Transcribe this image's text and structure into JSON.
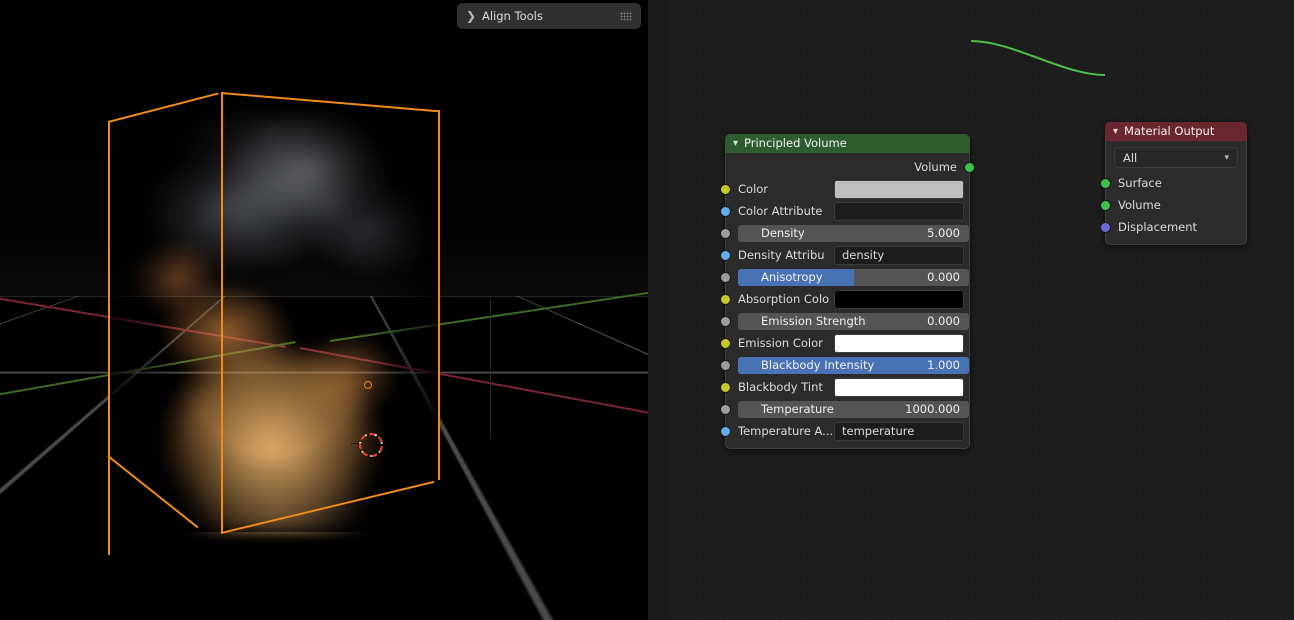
{
  "viewport": {
    "name": "3d-viewport",
    "object": "smoke-domain-volume",
    "overlay_panel": {
      "title": "Align Tools",
      "expand_icon": "chevron-right-icon",
      "grip_icon": "grip-dots-icon"
    },
    "axis_colors": {
      "x": "#7a2434",
      "y": "#3f6a22"
    },
    "selection_color": "#f08a18",
    "grid_color": "#787878"
  },
  "node_editor": {
    "name": "shader-node-editor",
    "background": "#1d1d1d",
    "link_color": "#4cbf4c",
    "nodes": [
      {
        "id": "principled-volume",
        "title": "Principled Volume",
        "header_color": "#2e5c2e",
        "collapse_icon": "chevron-down-icon",
        "outputs": [
          {
            "label": "Volume",
            "socket": "shader",
            "color": "#3fc14b"
          }
        ],
        "inputs": [
          {
            "label": "Color",
            "socket": "color",
            "widget": "swatch",
            "value": "#bfbfbf"
          },
          {
            "label": "Color Attribute",
            "socket": "string",
            "widget": "text",
            "value": ""
          },
          {
            "label": "Density",
            "socket": "float",
            "widget": "number",
            "value": "5.000",
            "fill": 0
          },
          {
            "label": "Density Attribu",
            "socket": "string",
            "widget": "text",
            "value": "density"
          },
          {
            "label": "Anisotropy",
            "socket": "float",
            "widget": "slider",
            "value": "0.000",
            "fill": 50
          },
          {
            "label": "Absorption Colo",
            "socket": "color",
            "widget": "swatch",
            "value": "#000000"
          },
          {
            "label": "Emission Strength",
            "socket": "float",
            "widget": "number",
            "value": "0.000",
            "fill": 0
          },
          {
            "label": "Emission Color",
            "socket": "color",
            "widget": "swatch",
            "value": "#ffffff"
          },
          {
            "label": "Blackbody Intensity",
            "socket": "float",
            "widget": "slider",
            "value": "1.000",
            "fill": 100
          },
          {
            "label": "Blackbody Tint",
            "socket": "color",
            "widget": "swatch",
            "value": "#ffffff"
          },
          {
            "label": "Temperature",
            "socket": "float",
            "widget": "number",
            "value": "1000.000",
            "fill": 0
          },
          {
            "label": "Temperature A...",
            "socket": "string",
            "widget": "text",
            "value": "temperature"
          }
        ]
      },
      {
        "id": "material-output",
        "title": "Material Output",
        "header_color": "#6b2730",
        "collapse_icon": "chevron-down-icon",
        "target_dropdown": {
          "value": "All",
          "icon": "chevron-down-icon"
        },
        "inputs": [
          {
            "label": "Surface",
            "socket": "shader",
            "color": "#3fc14b"
          },
          {
            "label": "Volume",
            "socket": "shader",
            "color": "#3fc14b"
          },
          {
            "label": "Displacement",
            "socket": "vector",
            "color": "#6b6bd8"
          }
        ]
      }
    ]
  }
}
